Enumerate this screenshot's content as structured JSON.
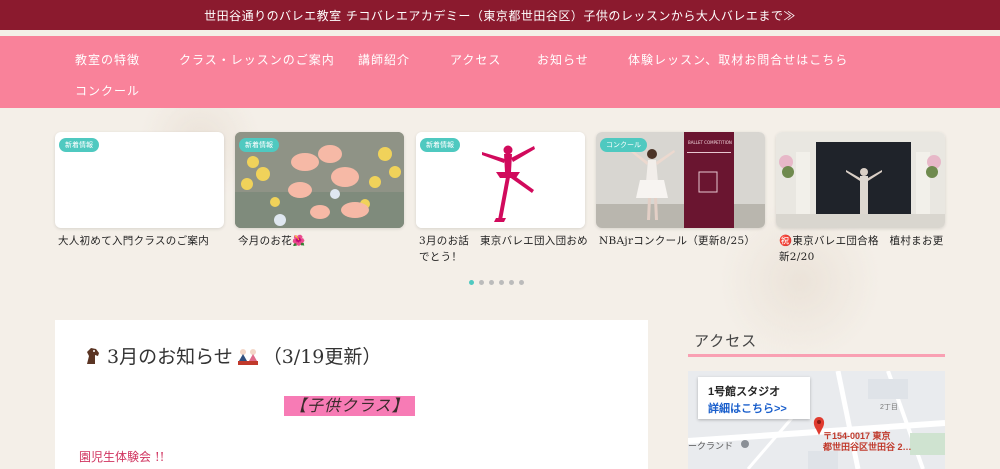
{
  "topbar": {
    "text": "世田谷通りのバレエ教室 チコバレエアカデミー（東京都世田谷区）子供のレッスンから大人バレエまで≫"
  },
  "nav": {
    "items": [
      {
        "label": "教室の特徴"
      },
      {
        "label": "クラス・レッスンのご案内"
      },
      {
        "label": "講師紹介"
      },
      {
        "label": "アクセス"
      },
      {
        "label": "お知らせ"
      },
      {
        "label": "体験レッスン、取材お問合せはこちら"
      },
      {
        "label": "コンクール"
      }
    ]
  },
  "slider": {
    "cards": [
      {
        "badge": "新着情報",
        "caption": "大人初めて入門クラスのご案内"
      },
      {
        "badge": "新着情報",
        "caption": "今月のお花🌺"
      },
      {
        "badge": "新着情報",
        "caption": "3月のお話　東京バレエ団入団おめでとう！"
      },
      {
        "badge": "コンクール",
        "caption": "NBAjrコンクール（更新8/25）",
        "poster_text": "BALLET COMPETITION"
      },
      {
        "badge": "",
        "caption": "㊗️東京バレエ団合格　植村まお更新2/20"
      }
    ],
    "active_index": 0
  },
  "post": {
    "title": "3月のお知らせ",
    "title_suffix": "（3/19更新）",
    "section_label": "【子供クラス】",
    "first_line": "園児生体験会 !!"
  },
  "sidebar": {
    "access_title": "アクセス",
    "map": {
      "card_title": "1号館スタジオ",
      "card_link": "詳細はこちら>>",
      "pin_label_line1": "〒154-0017 東京",
      "pin_label_line2": "都世田谷区世田谷 2…",
      "place_label": "ークランド",
      "street_label": "2丁目"
    }
  },
  "colors": {
    "topbar": "#8b1a2e",
    "nav": "#f9829a",
    "badge": "#4fc9c0",
    "section_highlight": "#f77bb5",
    "accent_text": "#d0335f"
  }
}
